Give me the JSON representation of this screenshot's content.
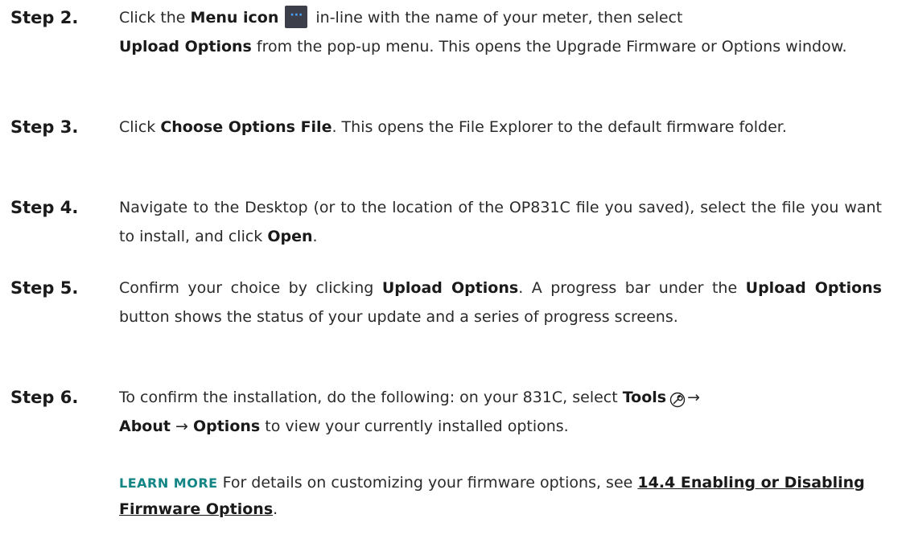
{
  "steps": [
    {
      "label": "Step 2.",
      "t1": "Click the ",
      "b1": "Menu icon",
      "icon": "menu-dots-icon",
      "t2": "in-line with the name of your meter, then select",
      "b2": "Upload Options",
      "t3": " from the pop-up menu. This opens the Upgrade Firmware or Options window."
    },
    {
      "label": "Step 3.",
      "t1": "Click ",
      "b1": "Choose Options File",
      "t2": ". This opens the File Explorer to the default firmware folder."
    },
    {
      "label": "Step 4.",
      "t1": "Navigate to the Desktop (or to the location of the OP831C file you saved), select the file you want to install, and click ",
      "b1": "Open",
      "t2": "."
    },
    {
      "label": "Step 5.",
      "t1": "Confirm your choice by clicking ",
      "b1": "Upload Options",
      "t2": ". A progress bar under the ",
      "b2": "Upload Options",
      "t3": " button shows the status of your update and a series of progress screens."
    },
    {
      "label": "Step 6.",
      "t1": "To confirm the installation, do the following: on your 831C, select ",
      "b1": "Tools",
      "icon": "wrench-icon",
      "arrow1": "→",
      "b2": "About",
      "arrow2": " → ",
      "b3": "Options",
      "t2": " to view your currently installed options."
    }
  ],
  "learn_more": {
    "label": "LEARN MORE",
    "text": "For details on customizing your firmware options, see ",
    "link": "14.4 Enabling or Disabling Firmware Options",
    "end": "."
  },
  "colors": {
    "accent": "#128584",
    "menu_icon_bg": "#3c3f4a",
    "menu_icon_dots": "#4aa3ff"
  }
}
